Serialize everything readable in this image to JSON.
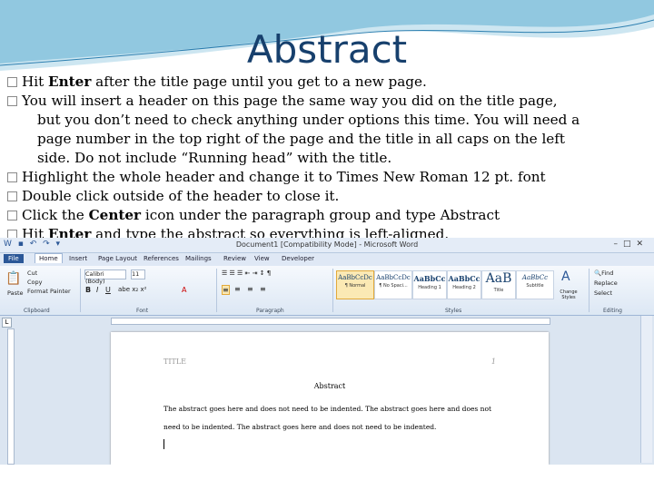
{
  "slide": {
    "title": "Abstract",
    "bullets": [
      {
        "pre": "Hit ",
        "kw": "Enter",
        "post": " after the title page until you get to a new page."
      },
      {
        "line1": "You will insert a header on this page the same way you did on the title page,",
        "line2": "but you don’t need to check anything under options this time.  You will need a",
        "line3": "page number in the top right of the page and the title in all caps on the left",
        "line4": "side.  Do not include “Running head” with the title."
      },
      {
        "text": "Highlight the whole header and change it to Times New Roman 12 pt. font"
      },
      {
        "text": "Double click outside of the header to close it."
      },
      {
        "pre": "Click the ",
        "kw": "Center",
        "post": " icon under the paragraph group and type Abstract"
      },
      {
        "pre": "Hit ",
        "kw": "Enter",
        "post": " and type the abstract so everything is left-aligned."
      }
    ]
  },
  "word": {
    "window_title": "Document1 [Compatibility Mode] - Microsoft Word",
    "tabs": [
      "Home",
      "Insert",
      "Page Layout",
      "References",
      "Mailings",
      "Review",
      "View",
      "Developer"
    ],
    "file_tab": "File",
    "clipboard": {
      "paste": "Paste",
      "cut": "Cut",
      "copy": "Copy",
      "format_painter": "Format Painter",
      "label": "Clipboard"
    },
    "font": {
      "name": "Calibri (Body)",
      "size": "11",
      "label": "Font"
    },
    "paragraph_label": "Paragraph",
    "styles": [
      {
        "sample": "AaBbCcDc",
        "name": "¶ Normal"
      },
      {
        "sample": "AaBbCcDc",
        "name": "¶ No Spaci..."
      },
      {
        "sample": "AaBbCc",
        "name": "Heading 1"
      },
      {
        "sample": "AaBbCc",
        "name": "Heading 2"
      },
      {
        "sample": "AaB",
        "name": "Title"
      },
      {
        "sample": "AaBbCc",
        "name": "Subtitle"
      }
    ],
    "styles_label": "Styles",
    "change_styles": "Change Styles",
    "editing": {
      "find": "Find",
      "replace": "Replace",
      "select": "Select",
      "label": "Editing"
    },
    "header_title": "TITLE",
    "header_page_num": "1",
    "page_heading": "Abstract",
    "body_line1": "The abstract goes here and does not need to be indented.  The abstract goes here and does not",
    "body_line2": "need to be indented.  The abstract goes here and does not need to be indented."
  }
}
